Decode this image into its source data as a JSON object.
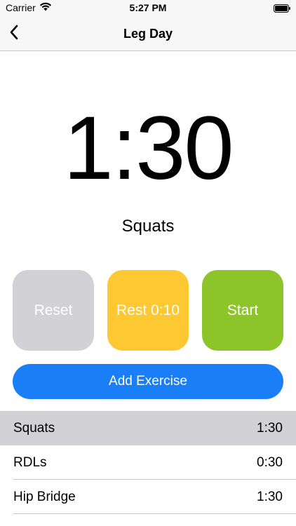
{
  "status_bar": {
    "carrier": "Carrier",
    "time": "5:27 PM",
    "icons": [
      "wifi-icon",
      "battery-icon"
    ]
  },
  "nav": {
    "title": "Leg Day",
    "back_icon": "chevron-left-icon"
  },
  "timer": {
    "display": "1:30",
    "current_exercise": "Squats"
  },
  "actions": {
    "reset_label": "Reset",
    "rest_label": "Rest 0:10",
    "start_label": "Start",
    "add_label": "Add Exercise"
  },
  "colors": {
    "reset": "#d1d1d6",
    "rest": "#fdc831",
    "start": "#8cc42a",
    "add": "#1a7ff7",
    "selected_row": "#d1d1d6"
  },
  "exercises": [
    {
      "name": "Squats",
      "duration": "1:30",
      "selected": true
    },
    {
      "name": "RDLs",
      "duration": "0:30",
      "selected": false
    },
    {
      "name": "Hip Bridge",
      "duration": "1:30",
      "selected": false
    }
  ]
}
